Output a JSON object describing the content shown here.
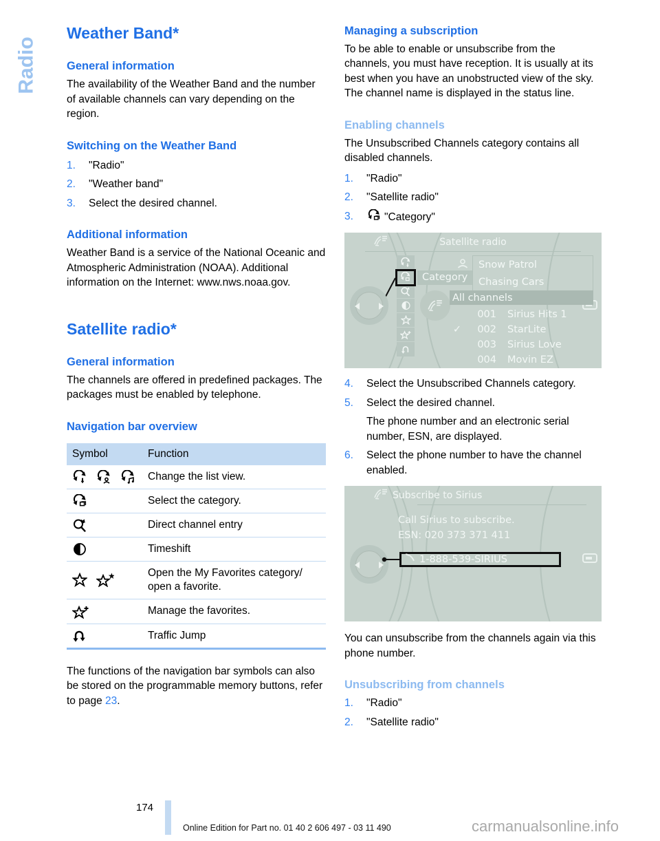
{
  "chapter_tab": {
    "label": "Radio"
  },
  "left_column": {
    "title": "Weather Band*",
    "sections": [
      {
        "heading": "General information",
        "body": "The availability of the Weather Band and the number of available channels can vary depending on the region."
      },
      {
        "heading": "Switching on the Weather Band",
        "steps": [
          {
            "num": "1.",
            "text": "\"Radio\""
          },
          {
            "num": "2.",
            "text": "\"Weather band\""
          },
          {
            "num": "3.",
            "text": "Select the desired channel."
          }
        ]
      },
      {
        "heading": "Additional information",
        "body": "Weather Band is a service of the National Oceanic and Atmospheric Administration (NOAA). Additional information on the Internet: www.nws.noaa.gov."
      }
    ],
    "title2": "Satellite radio*",
    "sections2": [
      {
        "heading": "General information",
        "body": "The channels are offered in predefined packages. The packages must be enabled by telephone."
      },
      {
        "heading": "Navigation bar overview"
      }
    ],
    "nav_table": {
      "headers": [
        "Symbol",
        "Function"
      ],
      "rows": [
        {
          "icons": [
            "list-view-arrow-icon",
            "list-view-person-icon",
            "list-view-music-icon"
          ],
          "function": "Change the list view."
        },
        {
          "icons": [
            "select-category-icon"
          ],
          "function": "Select the category."
        },
        {
          "icons": [
            "direct-channel-entry-icon"
          ],
          "function": "Direct channel entry"
        },
        {
          "icons": [
            "timeshift-icon"
          ],
          "function": "Timeshift"
        },
        {
          "icons": [
            "star-icon",
            "star-asterisk-icon"
          ],
          "function": "Open the My Favorites category/ open a favorite."
        },
        {
          "icons": [
            "star-plus-icon"
          ],
          "function": "Manage the favorites."
        },
        {
          "icons": [
            "traffic-jump-icon"
          ],
          "function": "Traffic Jump"
        }
      ]
    },
    "closing_paragraph": {
      "pre": "The functions of the navigation bar symbols can also be stored on the programmable memory buttons, refer to page ",
      "page_ref": "23",
      "post": "."
    }
  },
  "right_column": {
    "sections": [
      {
        "heading": "Managing a subscription",
        "heading_style": "dark",
        "body": "To be able to enable or unsubscribe from the channels, you must have reception. It is usually at its best when you have an unobstructed view of the sky. The channel name is displayed in the status line."
      },
      {
        "heading": "Enabling channels",
        "heading_style": "light",
        "body": "The Unsubscribed Channels category contains all disabled channels."
      }
    ],
    "steps_a": [
      {
        "num": "1.",
        "text": "\"Radio\"",
        "icon": ""
      },
      {
        "num": "2.",
        "text": "\"Satellite radio\"",
        "icon": ""
      },
      {
        "num": "3.",
        "text": "\"Category\"",
        "icon": "select-category-icon"
      }
    ],
    "steps_b": [
      {
        "num": "4.",
        "text": "Select the Unsubscribed Channels category."
      },
      {
        "num": "5.",
        "text": "Select the desired channel."
      },
      {
        "num": "",
        "text": "The phone number and an electronic serial number, ESN, are displayed."
      },
      {
        "num": "6.",
        "text": "Select the phone number to have the channel enabled."
      }
    ],
    "after_image_body": "You can unsubscribe from the channels again via this phone number.",
    "unsubscribe_section": {
      "heading": "Unsubscribing from channels",
      "heading_style": "light",
      "steps": [
        {
          "num": "1.",
          "text": "\"Radio\""
        },
        {
          "num": "2.",
          "text": "\"Satellite radio\""
        }
      ]
    }
  },
  "idrive_screenshot_1": {
    "status_icon": "satellite-radio-status-icon",
    "title": "Satellite radio",
    "navbar_icons": [
      "list-view-arrow-icon",
      "select-category-icon",
      "direct-channel-entry-icon",
      "timeshift-icon",
      "star-icon",
      "star-plus-icon",
      "traffic-jump-icon"
    ],
    "selected_navbar_index": 1,
    "category_chip": "Category",
    "favorites_icon": "person-icon",
    "favorites": [
      "Snow Patrol",
      "Chasing Cars"
    ],
    "list_header": "All channels",
    "channels": [
      {
        "check": "",
        "number": "001",
        "name": "Sirius Hits 1"
      },
      {
        "check": "✓",
        "number": "002",
        "name": "StarLite"
      },
      {
        "check": "",
        "number": "003",
        "name": "Sirius Love"
      },
      {
        "check": "",
        "number": "004",
        "name": "Movin EZ"
      }
    ]
  },
  "idrive_screenshot_2": {
    "status_icon": "satellite-radio-status-icon",
    "title": "Subscribe to Sirius",
    "message_line_1": "Call Sirius to subscribe.",
    "message_line_2": "ESN: 020 373 371 411",
    "phone_icon": "phone-handset-icon",
    "phone_number": "1-888-539-SIRIUS"
  },
  "footer": {
    "page_number": "174",
    "edition_text": "Online Edition for Part no. 01 40 2 606 497 - 03 11 490",
    "watermark": "carmanualsonline.info"
  },
  "colors": {
    "heading_blue": "#1f6fe5",
    "heading_light_blue": "#8cbaf0",
    "tab_blue": "#9dc4f0",
    "table_header": "#c3daf2",
    "idrive_bg": "#c7d3cd"
  }
}
